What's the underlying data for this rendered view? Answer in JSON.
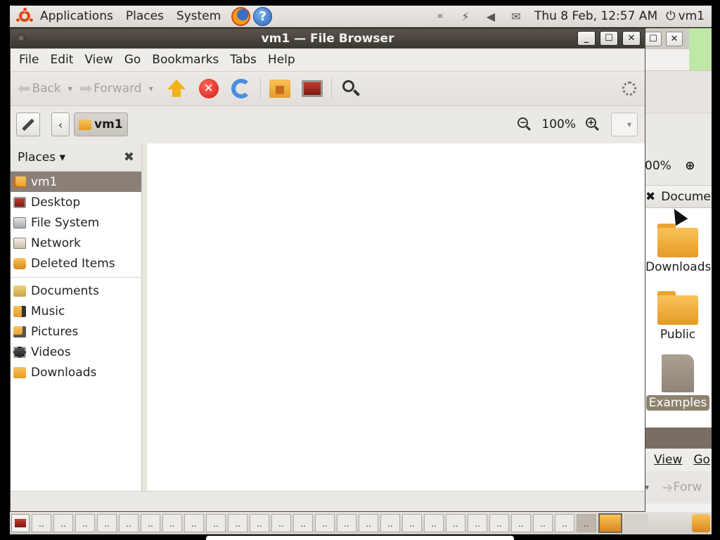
{
  "top_panel": {
    "menus": [
      "Applications",
      "Places",
      "System"
    ],
    "clock": "Thu  8 Feb, 12:57 AM",
    "user": "vm1"
  },
  "window": {
    "title": "vm1 — File Browser",
    "menubar": [
      "File",
      "Edit",
      "View",
      "Go",
      "Bookmarks",
      "Tabs",
      "Help"
    ],
    "toolbar": {
      "back_label": "Back",
      "forward_label": "Forward"
    },
    "location": {
      "crumb": "vm1",
      "zoom": "100%"
    },
    "sidebar": {
      "header": "Places",
      "places": [
        {
          "label": "vm1",
          "icon": "home-folder-icon",
          "selected": true
        },
        {
          "label": "Desktop",
          "icon": "desktop-icon"
        },
        {
          "label": "File System",
          "icon": "drive-icon"
        },
        {
          "label": "Network",
          "icon": "network-icon"
        },
        {
          "label": "Deleted Items",
          "icon": "trash-icon"
        }
      ],
      "bookmarks": [
        {
          "label": "Documents",
          "icon": "documents-folder-icon"
        },
        {
          "label": "Music",
          "icon": "music-folder-icon"
        },
        {
          "label": "Pictures",
          "icon": "pictures-folder-icon"
        },
        {
          "label": "Videos",
          "icon": "videos-folder-icon"
        },
        {
          "label": "Downloads",
          "icon": "downloads-folder-icon"
        }
      ]
    }
  },
  "background_window": {
    "zoom": "00%",
    "column_header": "Docume",
    "files": [
      "Downloads",
      "Public",
      "Examples"
    ],
    "menus": [
      "View",
      "Go"
    ],
    "forward_label": "Forw"
  },
  "bottom_panel": {
    "workspace_label": ".."
  },
  "colors": {
    "selection": "#8b8078",
    "titlebar": "#3c3732",
    "folder": "#f2b21b"
  }
}
